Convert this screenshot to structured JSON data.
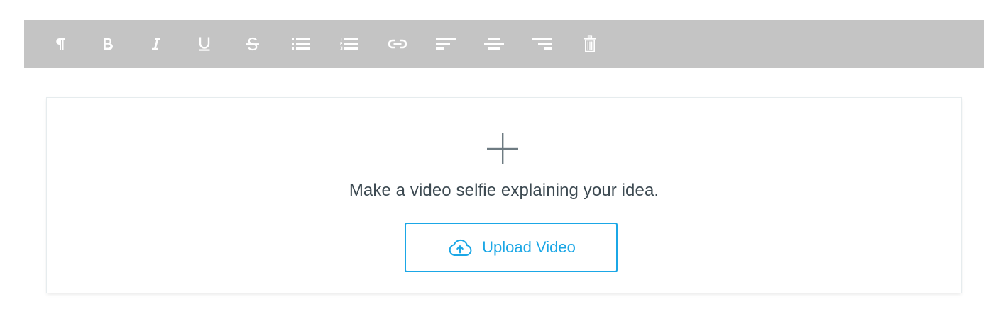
{
  "toolbar": {
    "tools": [
      {
        "name": "paragraph",
        "icon": "paragraph-icon"
      },
      {
        "name": "bold",
        "icon": "bold-icon"
      },
      {
        "name": "italic",
        "icon": "italic-icon"
      },
      {
        "name": "underline",
        "icon": "underline-icon"
      },
      {
        "name": "strikethrough",
        "icon": "strikethrough-icon"
      },
      {
        "name": "bulleted-list",
        "icon": "bulleted-list-icon"
      },
      {
        "name": "numbered-list",
        "icon": "numbered-list-icon"
      },
      {
        "name": "link",
        "icon": "link-icon"
      },
      {
        "name": "align-left",
        "icon": "align-left-icon"
      },
      {
        "name": "align-center",
        "icon": "align-center-icon"
      },
      {
        "name": "align-right",
        "icon": "align-right-icon"
      },
      {
        "name": "delete",
        "icon": "trash-icon"
      }
    ],
    "background": "#c4c4c4",
    "icon_color": "#ffffff"
  },
  "video_block": {
    "add_icon": "plus-icon",
    "prompt": "Make a video selfie explaining your idea.",
    "upload_button": {
      "icon": "cloud-upload-icon",
      "label": "Upload Video"
    },
    "accent_color": "#1ba7e6"
  }
}
